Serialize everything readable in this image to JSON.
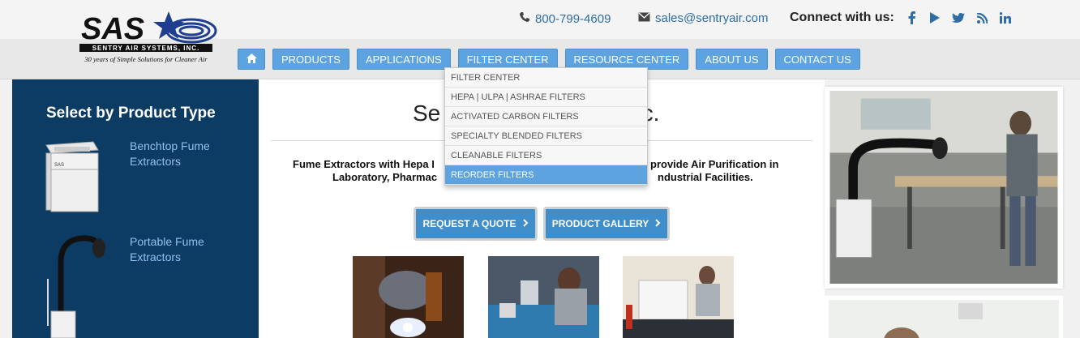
{
  "header": {
    "logo_text": "SAS",
    "logo_subtitle": "SENTRY AIR SYSTEMS, INC.",
    "logo_tagline": "30 years of Simple Solutions for Cleaner Air",
    "phone": "800-799-4609",
    "email": "sales@sentryair.com",
    "connect_label": "Connect with us:",
    "social_icons": [
      "facebook-icon",
      "youtube-icon",
      "twitter-icon",
      "rss-icon",
      "linkedin-icon"
    ]
  },
  "nav": {
    "items": [
      "PRODUCTS",
      "APPLICATIONS",
      "FILTER CENTER",
      "RESOURCE CENTER",
      "ABOUT US",
      "CONTACT US"
    ]
  },
  "dropdown": {
    "items": [
      "FILTER CENTER",
      "HEPA | ULPA | ASHRAE FILTERS",
      "ACTIVATED CARBON FILTERS",
      "SPECIALTY BLENDED FILTERS",
      "CLEANABLE FILTERS",
      "REORDER FILTERS"
    ],
    "active_index": 5
  },
  "sidebar": {
    "title": "Select by Product Type",
    "products": [
      {
        "line1": "Benchtop Fume",
        "line2": "Extractors"
      },
      {
        "line1": "Portable Fume",
        "line2": "Extractors"
      }
    ]
  },
  "main": {
    "title_left": "Se",
    "title_right": "nc.",
    "tagline_line1_left": "Fume Extractors with Hepa I",
    "tagline_line1_right": "provide Air Purification in",
    "tagline_line2_left": "Laboratory, Pharmac",
    "tagline_line2_right": "ndustrial Facilities.",
    "quote_button": "REQUEST A QUOTE",
    "gallery_button": "PRODUCT GALLERY"
  },
  "colors": {
    "accent": "#5da3df",
    "sidebar_bg": "#0c3c64",
    "link": "#2d6da3"
  }
}
